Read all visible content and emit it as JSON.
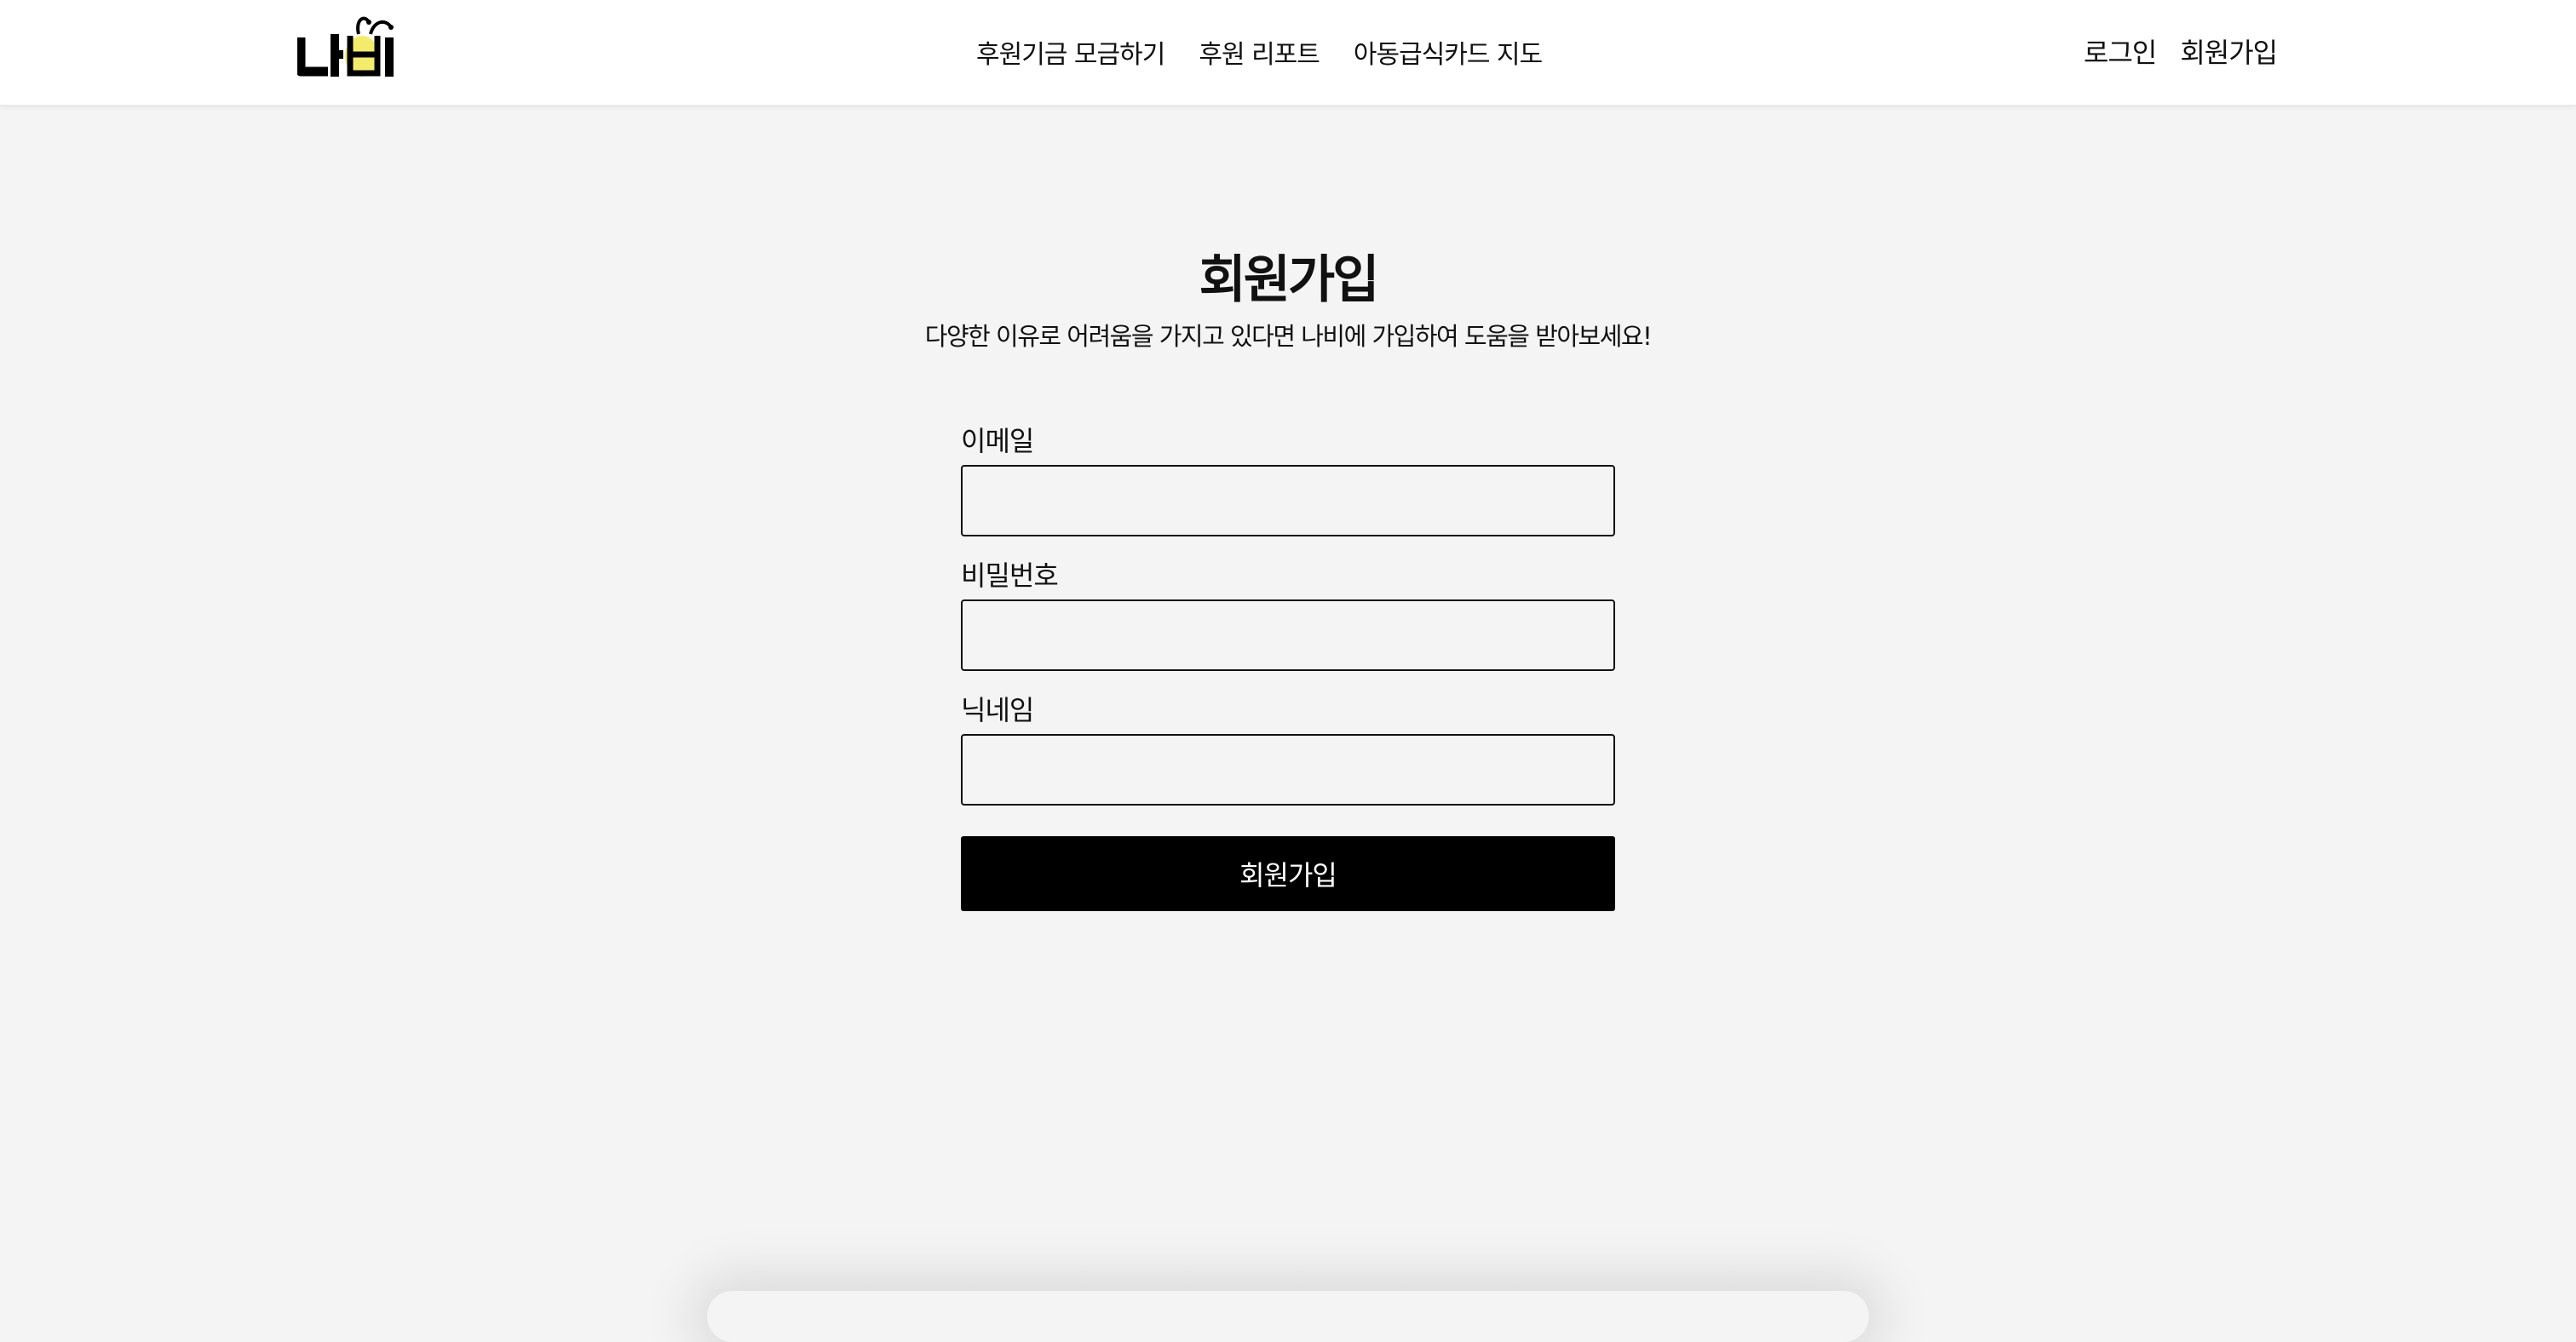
{
  "header": {
    "logo": {
      "text": "나비",
      "accent_color": "#f3ec6a"
    },
    "nav": [
      {
        "label": "후원기금 모금하기"
      },
      {
        "label": "후원 리포트"
      },
      {
        "label": "아동급식카드 지도"
      }
    ],
    "auth": {
      "login_label": "로그인",
      "signup_label": "회원가입"
    }
  },
  "main": {
    "title": "회원가입",
    "subtitle": "다양한 이유로 어려움을 가지고 있다면 나비에 가입하여 도움을 받아보세요!",
    "form": {
      "email_label": "이메일",
      "email_value": "",
      "password_label": "비밀번호",
      "password_value": "",
      "nickname_label": "닉네임",
      "nickname_value": "",
      "submit_label": "회원가입"
    }
  },
  "colors": {
    "background": "#f4f4f4",
    "header_bg": "#ffffff",
    "button_bg": "#000000",
    "button_text": "#ffffff"
  }
}
